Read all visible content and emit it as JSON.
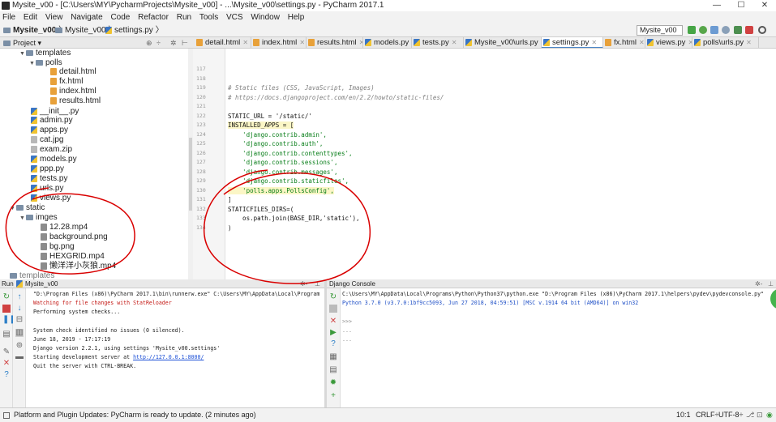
{
  "window": {
    "title": "Mysite_v00 - [C:\\Users\\MY\\PycharmProjects\\Mysite_v00] - ...\\Mysite_v00\\settings.py - PyCharm 2017.1",
    "min": "—",
    "max": "☐",
    "close": "✕"
  },
  "menu": [
    "File",
    "Edit",
    "View",
    "Navigate",
    "Code",
    "Refactor",
    "Run",
    "Tools",
    "VCS",
    "Window",
    "Help"
  ],
  "breadcrumb": {
    "project": "Mysite_v00",
    "folder": "Mysite_v00",
    "file": "settings.py"
  },
  "run_config": "Mysite_v00",
  "project_panel": {
    "title": "Project"
  },
  "tabs": [
    {
      "label": "detail.html",
      "type": "html"
    },
    {
      "label": "index.html",
      "type": "html"
    },
    {
      "label": "results.html",
      "type": "html"
    },
    {
      "label": "models.py",
      "type": "py"
    },
    {
      "label": "tests.py",
      "type": "py"
    },
    {
      "label": "Mysite_v00\\urls.py",
      "type": "py"
    },
    {
      "label": "settings.py",
      "type": "py",
      "active": true
    },
    {
      "label": "fx.html",
      "type": "html"
    },
    {
      "label": "views.py",
      "type": "py"
    },
    {
      "label": "polls\\urls.py",
      "type": "py"
    }
  ],
  "tree": [
    {
      "label": "templates",
      "type": "folder",
      "expanded": true
    },
    {
      "label": "polls",
      "type": "folder",
      "expanded": true
    },
    {
      "label": "detail.html",
      "type": "html"
    },
    {
      "label": "fx.html",
      "type": "html"
    },
    {
      "label": "index.html",
      "type": "html"
    },
    {
      "label": "results.html",
      "type": "html"
    },
    {
      "label": "__init__.py",
      "type": "py"
    },
    {
      "label": "admin.py",
      "type": "py"
    },
    {
      "label": "apps.py",
      "type": "py"
    },
    {
      "label": "cat.jpg",
      "type": "file"
    },
    {
      "label": "exam.zip",
      "type": "file"
    },
    {
      "label": "models.py",
      "type": "py"
    },
    {
      "label": "ppp.py",
      "type": "py"
    },
    {
      "label": "tests.py",
      "type": "py"
    },
    {
      "label": "urls.py",
      "type": "py"
    },
    {
      "label": "views.py",
      "type": "py"
    },
    {
      "label": "static",
      "type": "folder",
      "expanded": true
    },
    {
      "label": "imges",
      "type": "folder",
      "expanded": true
    },
    {
      "label": "12.28.mp4",
      "type": "media"
    },
    {
      "label": "background.png",
      "type": "media"
    },
    {
      "label": "bg.png",
      "type": "media"
    },
    {
      "label": "HEXGRID.mp4",
      "type": "media"
    },
    {
      "label": "懒洋洋小灰狼.mp4",
      "type": "media"
    },
    {
      "label": "templates",
      "type": "folder"
    }
  ],
  "code": {
    "line_numbers": [
      "117",
      "118",
      "119",
      "120",
      "121",
      "122",
      "123",
      "124",
      "125",
      "126",
      "127",
      "128",
      "129",
      "130",
      "131",
      "132",
      "133",
      "134"
    ],
    "lines": [
      {
        "text": "",
        "cls": ""
      },
      {
        "text": "",
        "cls": ""
      },
      {
        "text": "# Static files (CSS, JavaScript, Images)",
        "cls": "cmt"
      },
      {
        "text": "# https://docs.djangoproject.com/en/2.2/howto/static-files/",
        "cls": "cmt"
      },
      {
        "text": "",
        "cls": ""
      },
      {
        "text": "STATIC_URL = '/static/'",
        "cls": ""
      },
      {
        "text": "INSTALLED_APPS = [",
        "cls": ""
      },
      {
        "text": "    'django.contrib.admin',",
        "cls": "str"
      },
      {
        "text": "    'django.contrib.auth',",
        "cls": "str"
      },
      {
        "text": "    'django.contrib.contenttypes',",
        "cls": "str"
      },
      {
        "text": "    'django.contrib.sessions',",
        "cls": "str"
      },
      {
        "text": "    'django.contrib.messages',",
        "cls": "str"
      },
      {
        "text": "    'django.contrib.staticfiles',",
        "cls": "str"
      },
      {
        "text": "    'polls.apps.PollsConfig',",
        "cls": "str hl"
      },
      {
        "text": "]",
        "cls": ""
      },
      {
        "text": "STATICFILES_DIRS=(",
        "cls": ""
      },
      {
        "text": "    os.path.join(BASE_DIR,'static'),",
        "cls": ""
      },
      {
        "text": ")",
        "cls": ""
      }
    ]
  },
  "run_panel": {
    "header": "Run",
    "config": "Mysite_v00",
    "output": [
      {
        "text": "\"D:\\Program Files (x86)\\PyCharm 2017.1\\bin\\runnerw.exe\" C:\\Users\\MY\\AppData\\Local\\Program",
        "cls": ""
      },
      {
        "text": "Watching for file changes with StatReloader",
        "cls": "red"
      },
      {
        "text": "Performing system checks...",
        "cls": ""
      },
      {
        "text": "",
        "cls": ""
      },
      {
        "text": "System check identified no issues (0 silenced).",
        "cls": ""
      },
      {
        "text": "June 18, 2019 - 17:17:19",
        "cls": ""
      },
      {
        "text": "Django version 2.2.1, using settings 'Mysite_v00.settings'",
        "cls": ""
      },
      {
        "text": "Starting development server at ",
        "cls": "",
        "link": "http://127.0.0.1:8000/"
      },
      {
        "text": "Quit the server with CTRL-BREAK.",
        "cls": ""
      }
    ]
  },
  "django_console": {
    "header": "Django Console",
    "output": [
      {
        "text": "C:\\Users\\MY\\AppData\\Local\\Programs\\Python\\Python37\\python.exe \"D:\\Program Files (x86)\\PyCharm 2017.1\\helpers\\pydev\\pydevconsole.py\"",
        "cls": ""
      },
      {
        "text": "Python 3.7.0 (v3.7.0:1bf9cc5093, Jun 27 2018, 04:59:51) [MSC v.1914 64 bit (AMD64)] on win32",
        "cls": "blue"
      },
      {
        "text": "",
        "cls": ""
      },
      {
        "text": ">>>",
        "cls": ""
      },
      {
        "text": "...",
        "cls": ""
      },
      {
        "text": "...",
        "cls": ""
      }
    ]
  },
  "statusbar": {
    "message": "Platform and Plugin Updates: PyCharm is ready to update. (2 minutes ago)",
    "position": "10:1",
    "line_sep": "CRLF÷",
    "encoding": "UTF-8÷"
  },
  "colors": {
    "accent": "#4a86c8",
    "annotation": "#d90000"
  }
}
